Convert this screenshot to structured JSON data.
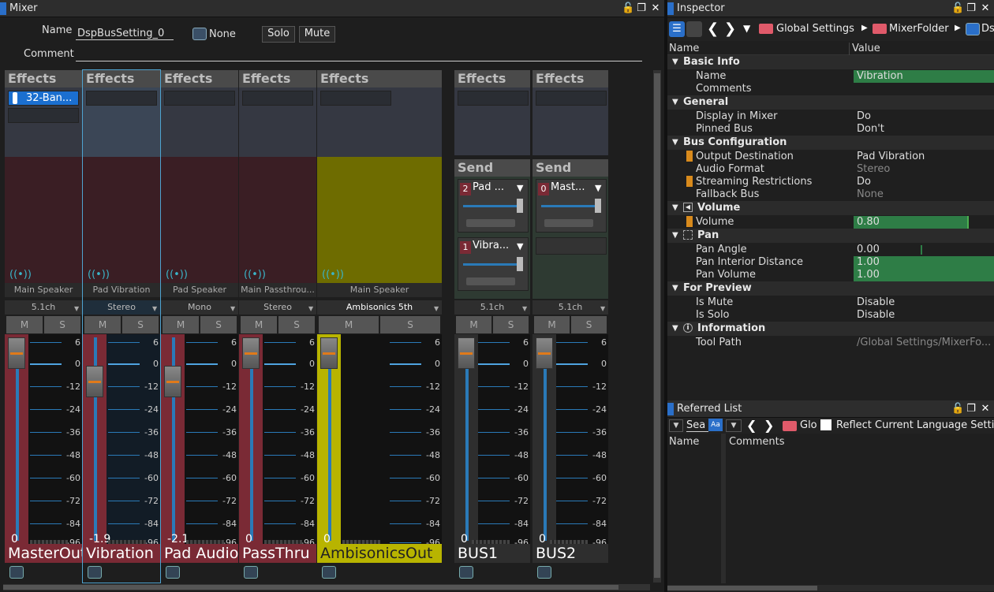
{
  "mixer": {
    "title": "Mixer",
    "name_label": "Name",
    "name_value": "DspBusSetting_0",
    "none_label": "None",
    "solo_label": "Solo",
    "mute_label": "Mute",
    "comment_label": "Comment",
    "effects_label": "Effects",
    "send_label": "Send",
    "fx_slot_text": "32-Ban...",
    "strips": [
      {
        "route": "Main Speaker",
        "format": "5.1ch",
        "value": "0",
        "name": "MasterOut",
        "color": "#7a2a35"
      },
      {
        "route": "Pad Vibration",
        "format": "Stereo",
        "value": "-1.9",
        "name": "Vibration",
        "color": "#7a2a35"
      },
      {
        "route": "Pad Speaker",
        "format": "Mono",
        "value": "-2.1",
        "name": "Pad Audio",
        "color": "#7a2a35"
      },
      {
        "route": "Main Passthrou...",
        "format": "Stereo",
        "value": "0",
        "name": "PassThru",
        "color": "#7a2a35"
      },
      {
        "route": "Main Speaker",
        "format": "Ambisonics 5th",
        "value": "0",
        "name": "AmbisonicsOut",
        "color": "#b8b400"
      }
    ],
    "buses": [
      {
        "format": "5.1ch",
        "value": "0",
        "name": "BUS1",
        "send1_num": "2",
        "send1_label": "Pad ...",
        "send2_num": "1",
        "send2_label": "Vibra..."
      },
      {
        "format": "5.1ch",
        "value": "0",
        "name": "BUS2",
        "send1_num": "0",
        "send1_label": "Mast..."
      }
    ],
    "mute_btn": "M",
    "solo_btn": "S",
    "scale": [
      "6",
      "0",
      "-12",
      "-24",
      "-36",
      "-48",
      "-60",
      "-72",
      "-84",
      "-96"
    ]
  },
  "inspector": {
    "title": "Inspector",
    "crumbs": [
      "Global Settings",
      "MixerFolder",
      "Ds"
    ],
    "col_name": "Name",
    "col_value": "Value",
    "cats": {
      "basic": "Basic Info",
      "general": "General",
      "busconf": "Bus Configuration",
      "volume": "Volume",
      "pan": "Pan",
      "preview": "For Preview",
      "info": "Information"
    },
    "rows": {
      "name": {
        "n": "Name",
        "v": "Vibration"
      },
      "comments": {
        "n": "Comments",
        "v": ""
      },
      "display": {
        "n": "Display in Mixer",
        "v": "Do"
      },
      "pinned": {
        "n": "Pinned Bus",
        "v": "Don't"
      },
      "output": {
        "n": "Output Destination",
        "v": "Pad Vibration"
      },
      "audiofmt": {
        "n": "Audio Format",
        "v": "Stereo"
      },
      "stream": {
        "n": "Streaming Restrictions",
        "v": "Do"
      },
      "fallback": {
        "n": "Fallback Bus",
        "v": "None"
      },
      "volume": {
        "n": "Volume",
        "v": "0.80"
      },
      "panangle": {
        "n": "Pan Angle",
        "v": "0.00"
      },
      "panint": {
        "n": "Pan Interior Distance",
        "v": "1.00"
      },
      "panvol": {
        "n": "Pan Volume",
        "v": "1.00"
      },
      "ismute": {
        "n": "Is Mute",
        "v": "Disable"
      },
      "issolo": {
        "n": "Is Solo",
        "v": "Disable"
      },
      "toolpath": {
        "n": "Tool Path",
        "v": "/Global Settings/MixerFo..."
      }
    }
  },
  "referred": {
    "title": "Referred List",
    "search": "Sea",
    "case_btn": "Aa",
    "folder": "Glo",
    "reflect": "Reflect Current Language Setti",
    "col_name": "Name",
    "col_comments": "Comments"
  }
}
